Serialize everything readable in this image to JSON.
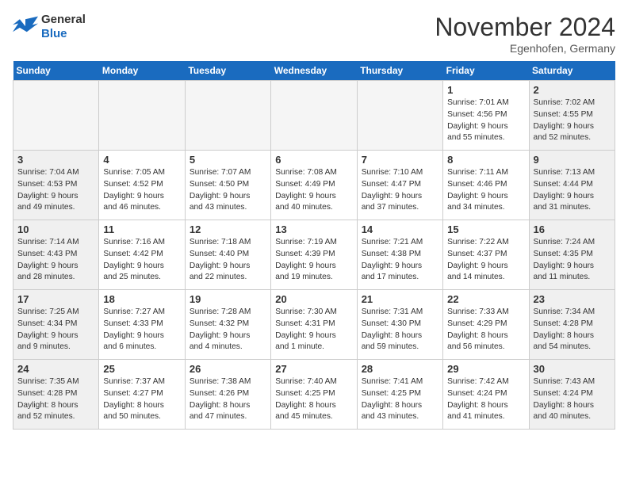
{
  "header": {
    "logo_general": "General",
    "logo_blue": "Blue",
    "title": "November 2024",
    "location": "Egenhofen, Germany"
  },
  "columns": [
    "Sunday",
    "Monday",
    "Tuesday",
    "Wednesday",
    "Thursday",
    "Friday",
    "Saturday"
  ],
  "rows": [
    [
      {
        "day": "",
        "info": "",
        "type": "empty"
      },
      {
        "day": "",
        "info": "",
        "type": "empty"
      },
      {
        "day": "",
        "info": "",
        "type": "empty"
      },
      {
        "day": "",
        "info": "",
        "type": "empty"
      },
      {
        "day": "",
        "info": "",
        "type": "empty"
      },
      {
        "day": "1",
        "info": "Sunrise: 7:01 AM\nSunset: 4:56 PM\nDaylight: 9 hours\nand 55 minutes.",
        "type": "weekday"
      },
      {
        "day": "2",
        "info": "Sunrise: 7:02 AM\nSunset: 4:55 PM\nDaylight: 9 hours\nand 52 minutes.",
        "type": "weekend"
      }
    ],
    [
      {
        "day": "3",
        "info": "Sunrise: 7:04 AM\nSunset: 4:53 PM\nDaylight: 9 hours\nand 49 minutes.",
        "type": "weekend"
      },
      {
        "day": "4",
        "info": "Sunrise: 7:05 AM\nSunset: 4:52 PM\nDaylight: 9 hours\nand 46 minutes.",
        "type": "weekday"
      },
      {
        "day": "5",
        "info": "Sunrise: 7:07 AM\nSunset: 4:50 PM\nDaylight: 9 hours\nand 43 minutes.",
        "type": "weekday"
      },
      {
        "day": "6",
        "info": "Sunrise: 7:08 AM\nSunset: 4:49 PM\nDaylight: 9 hours\nand 40 minutes.",
        "type": "weekday"
      },
      {
        "day": "7",
        "info": "Sunrise: 7:10 AM\nSunset: 4:47 PM\nDaylight: 9 hours\nand 37 minutes.",
        "type": "weekday"
      },
      {
        "day": "8",
        "info": "Sunrise: 7:11 AM\nSunset: 4:46 PM\nDaylight: 9 hours\nand 34 minutes.",
        "type": "weekday"
      },
      {
        "day": "9",
        "info": "Sunrise: 7:13 AM\nSunset: 4:44 PM\nDaylight: 9 hours\nand 31 minutes.",
        "type": "weekend"
      }
    ],
    [
      {
        "day": "10",
        "info": "Sunrise: 7:14 AM\nSunset: 4:43 PM\nDaylight: 9 hours\nand 28 minutes.",
        "type": "weekend"
      },
      {
        "day": "11",
        "info": "Sunrise: 7:16 AM\nSunset: 4:42 PM\nDaylight: 9 hours\nand 25 minutes.",
        "type": "weekday"
      },
      {
        "day": "12",
        "info": "Sunrise: 7:18 AM\nSunset: 4:40 PM\nDaylight: 9 hours\nand 22 minutes.",
        "type": "weekday"
      },
      {
        "day": "13",
        "info": "Sunrise: 7:19 AM\nSunset: 4:39 PM\nDaylight: 9 hours\nand 19 minutes.",
        "type": "weekday"
      },
      {
        "day": "14",
        "info": "Sunrise: 7:21 AM\nSunset: 4:38 PM\nDaylight: 9 hours\nand 17 minutes.",
        "type": "weekday"
      },
      {
        "day": "15",
        "info": "Sunrise: 7:22 AM\nSunset: 4:37 PM\nDaylight: 9 hours\nand 14 minutes.",
        "type": "weekday"
      },
      {
        "day": "16",
        "info": "Sunrise: 7:24 AM\nSunset: 4:35 PM\nDaylight: 9 hours\nand 11 minutes.",
        "type": "weekend"
      }
    ],
    [
      {
        "day": "17",
        "info": "Sunrise: 7:25 AM\nSunset: 4:34 PM\nDaylight: 9 hours\nand 9 minutes.",
        "type": "weekend"
      },
      {
        "day": "18",
        "info": "Sunrise: 7:27 AM\nSunset: 4:33 PM\nDaylight: 9 hours\nand 6 minutes.",
        "type": "weekday"
      },
      {
        "day": "19",
        "info": "Sunrise: 7:28 AM\nSunset: 4:32 PM\nDaylight: 9 hours\nand 4 minutes.",
        "type": "weekday"
      },
      {
        "day": "20",
        "info": "Sunrise: 7:30 AM\nSunset: 4:31 PM\nDaylight: 9 hours\nand 1 minute.",
        "type": "weekday"
      },
      {
        "day": "21",
        "info": "Sunrise: 7:31 AM\nSunset: 4:30 PM\nDaylight: 8 hours\nand 59 minutes.",
        "type": "weekday"
      },
      {
        "day": "22",
        "info": "Sunrise: 7:33 AM\nSunset: 4:29 PM\nDaylight: 8 hours\nand 56 minutes.",
        "type": "weekday"
      },
      {
        "day": "23",
        "info": "Sunrise: 7:34 AM\nSunset: 4:28 PM\nDaylight: 8 hours\nand 54 minutes.",
        "type": "weekend"
      }
    ],
    [
      {
        "day": "24",
        "info": "Sunrise: 7:35 AM\nSunset: 4:28 PM\nDaylight: 8 hours\nand 52 minutes.",
        "type": "weekend"
      },
      {
        "day": "25",
        "info": "Sunrise: 7:37 AM\nSunset: 4:27 PM\nDaylight: 8 hours\nand 50 minutes.",
        "type": "weekday"
      },
      {
        "day": "26",
        "info": "Sunrise: 7:38 AM\nSunset: 4:26 PM\nDaylight: 8 hours\nand 47 minutes.",
        "type": "weekday"
      },
      {
        "day": "27",
        "info": "Sunrise: 7:40 AM\nSunset: 4:25 PM\nDaylight: 8 hours\nand 45 minutes.",
        "type": "weekday"
      },
      {
        "day": "28",
        "info": "Sunrise: 7:41 AM\nSunset: 4:25 PM\nDaylight: 8 hours\nand 43 minutes.",
        "type": "weekday"
      },
      {
        "day": "29",
        "info": "Sunrise: 7:42 AM\nSunset: 4:24 PM\nDaylight: 8 hours\nand 41 minutes.",
        "type": "weekday"
      },
      {
        "day": "30",
        "info": "Sunrise: 7:43 AM\nSunset: 4:24 PM\nDaylight: 8 hours\nand 40 minutes.",
        "type": "weekend"
      }
    ]
  ]
}
